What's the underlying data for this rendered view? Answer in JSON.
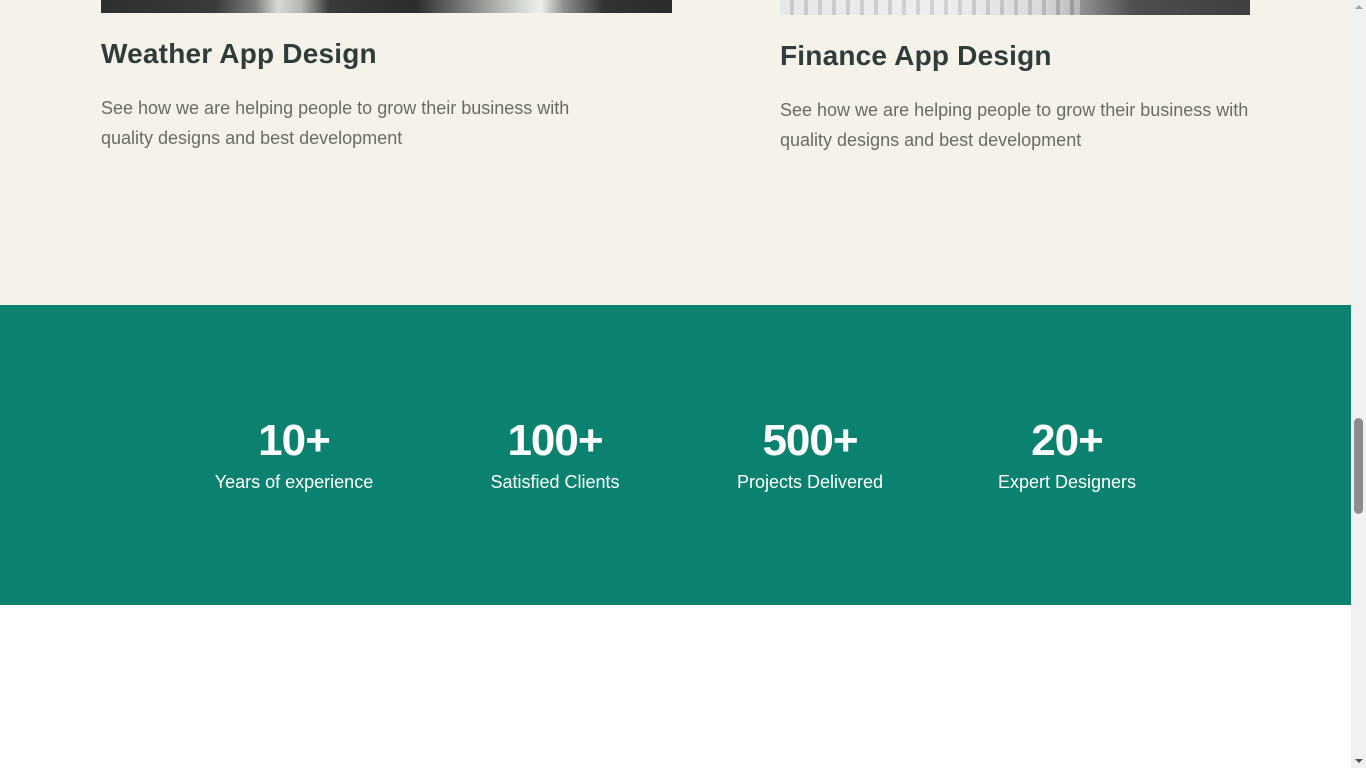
{
  "portfolio": {
    "cards": [
      {
        "title": "Weather App Design",
        "description": "See how we are helping people to grow their business with quality designs and best development"
      },
      {
        "title": "Finance App Design",
        "description": "See how we are helping people to grow their business with quality designs and best development"
      }
    ]
  },
  "stats": {
    "items": [
      {
        "value": "10+",
        "label": "Years of experience"
      },
      {
        "value": "100+",
        "label": "Satisfied Clients"
      },
      {
        "value": "500+",
        "label": "Projects Delivered"
      },
      {
        "value": "20+",
        "label": "Expert Designers"
      }
    ]
  },
  "colors": {
    "portfolio_bg": "#f5f2ea",
    "stats_bg": "#0b8270",
    "heading": "#2e3d39",
    "body_text": "#6b6b66",
    "stats_text": "#ffffff"
  },
  "scrollbar": {
    "scroll_fraction": 0.6
  }
}
